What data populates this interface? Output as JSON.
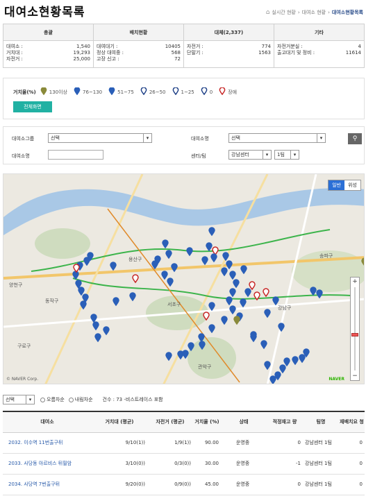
{
  "page": {
    "title": "대여소현황목록"
  },
  "breadcrumb": [
    "실시간 현황",
    "대여소 현황",
    "대여소현황목록"
  ],
  "stats": {
    "headers": [
      "총괄",
      "배치현황",
      "대체(2,337)",
      "기타"
    ],
    "columns": [
      [
        {
          "label": "대여소 :",
          "value": "1,540"
        },
        {
          "label": "거치대 :",
          "value": "19,293"
        },
        {
          "label": "자전거 :",
          "value": "25,000"
        }
      ],
      [
        {
          "label": "대여대기 :",
          "value": "10405"
        },
        {
          "label": "정상 대여중 :",
          "value": "568"
        },
        {
          "label": "고장 신고 :",
          "value": "72"
        }
      ],
      [
        {
          "label": "자전거 :",
          "value": "774"
        },
        {
          "label": "단말기 :",
          "value": "1563"
        }
      ],
      [
        {
          "label": "자전거분실 :",
          "value": "4"
        },
        {
          "label": "출고대기 및 정비 :",
          "value": "11614"
        }
      ]
    ]
  },
  "legend": {
    "title": "거치율(%)",
    "items": [
      {
        "label": "130이상",
        "color": "#8a8a3a",
        "hollow": false
      },
      {
        "label": "76~130",
        "color": "#2a5fb8",
        "hollow": false
      },
      {
        "label": "51~75",
        "color": "#2a5fb8",
        "hollow": false
      },
      {
        "label": "26~50",
        "color": "#1d3f86",
        "hollow": true
      },
      {
        "label": "1~25",
        "color": "#1d3f86",
        "hollow": true
      },
      {
        "label": "0",
        "color": "#1d3f86",
        "hollow": true
      },
      {
        "label": "장애",
        "color": "#c72525",
        "hollow": true
      }
    ],
    "fullscreen_label": "전체화면"
  },
  "search": {
    "group_label": "대여소그룹",
    "group_value": "선택",
    "station_label": "대여소명",
    "station_value": "선택",
    "name_label": "대여소명",
    "center_label": "센터/팀",
    "center_value": "강남센터",
    "team_value": "1팀"
  },
  "map": {
    "type_labels": [
      "일반",
      "위성"
    ],
    "places": [
      "용산구",
      "서초구",
      "강남구",
      "관악구",
      "구로구",
      "동작구",
      "송파구",
      "양천구"
    ],
    "copyright": "© NAVER Corp.",
    "brand": "NAVER"
  },
  "listbar": {
    "sort_value": "선택",
    "asc_label": "오름차순",
    "desc_label": "내림차순",
    "count_text": "건수 : 73 -비스트레이스 포함"
  },
  "table": {
    "headers": [
      "대여소",
      "거치대 (평균)",
      "자전거 (평균)",
      "거치율 (%)",
      "상태",
      "적정재고 량",
      "팀명",
      "재배치요 청"
    ],
    "rows": [
      [
        "2032. 이수역 11번출구뒤",
        "9/10(1))",
        "1/9(1))",
        "90.00",
        "운영중",
        "0",
        "강남센터 1팀",
        "0"
      ],
      [
        "2033. 사당동 아르비스 뒤필암",
        "3/10(0))",
        "0/3(0))",
        "30.00",
        "운영중",
        "-1",
        "강남센터 1팀",
        "0"
      ],
      [
        "2034. 사당역 7번출구뒤",
        "9/20(0))",
        "0/9(0))",
        "45.00",
        "운영중",
        "0",
        "강남센터 1팀",
        "0"
      ]
    ]
  }
}
